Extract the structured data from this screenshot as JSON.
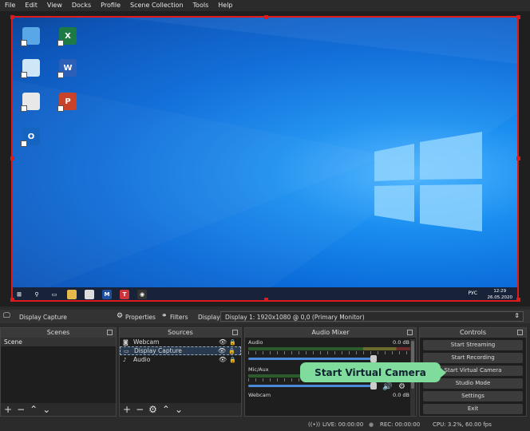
{
  "menu": [
    "File",
    "Edit",
    "View",
    "Docks",
    "Profile",
    "Scene Collection",
    "Tools",
    "Help"
  ],
  "desktop_icons": [
    {
      "name": "computer-icon",
      "glyph": "",
      "color": "#5aa7e8"
    },
    {
      "name": "excel-icon",
      "glyph": "X",
      "color": "#1d7a45"
    },
    {
      "name": "recycle-bin-icon",
      "glyph": "",
      "color": "#cfe6f7"
    },
    {
      "name": "word-icon",
      "glyph": "W",
      "color": "#2b5fb8"
    },
    {
      "name": "chrome-icon",
      "glyph": "",
      "color": "#e8e8e8"
    },
    {
      "name": "powerpoint-icon",
      "glyph": "P",
      "color": "#c9432a"
    },
    {
      "name": "outlook-icon",
      "glyph": "O",
      "color": "#1565c0"
    }
  ],
  "taskbar": {
    "lang": "РУС",
    "time": "12:29",
    "date": "26.05.2020",
    "apps": [
      {
        "name": "start-icon",
        "glyph": "⊞",
        "color": "transparent"
      },
      {
        "name": "search-icon",
        "glyph": "⚲",
        "color": "transparent"
      },
      {
        "name": "task-view-icon",
        "glyph": "▭",
        "color": "transparent"
      },
      {
        "name": "explorer-icon",
        "glyph": "",
        "color": "#e5b94a"
      },
      {
        "name": "chrome-task-icon",
        "glyph": "",
        "color": "#dcdcdc"
      },
      {
        "name": "malwarebytes-icon",
        "glyph": "M",
        "color": "#1f4fa0"
      },
      {
        "name": "t-app-icon",
        "glyph": "T",
        "color": "#d0343a"
      },
      {
        "name": "obs-icon",
        "glyph": "◉",
        "color": "#333"
      }
    ]
  },
  "source_bar": {
    "source_name": "Display Capture",
    "properties": "Properties",
    "filters": "Filters",
    "display_label": "Display",
    "display_value": "Display 1: 1920x1080 @ 0,0 (Primary Monitor)"
  },
  "scenes": {
    "title": "Scenes",
    "items": [
      "Scene"
    ]
  },
  "sources": {
    "title": "Sources",
    "items": [
      {
        "label": "Webcam",
        "icon": "camera-icon",
        "glyph": "◙"
      },
      {
        "label": "Display Capture",
        "icon": "monitor-icon",
        "glyph": "▭"
      },
      {
        "label": "Audio",
        "icon": "mic-icon",
        "glyph": "♪"
      }
    ]
  },
  "mixer": {
    "title": "Audio Mixer",
    "channels": [
      {
        "name": "Audio",
        "db": "0.0 dB"
      },
      {
        "name": "Mic/Aux",
        "db": ""
      },
      {
        "name": "Webcam",
        "db": "0.0 dB"
      }
    ]
  },
  "controls": {
    "title": "Controls",
    "buttons": [
      "Start Streaming",
      "Start Recording",
      "Start Virtual Camera",
      "Studio Mode",
      "Settings",
      "Exit"
    ]
  },
  "tooltip": "Start Virtual Camera",
  "status": {
    "live": "LIVE: 00:00:00",
    "rec": "REC: 00:00:00",
    "cpu": "CPU: 3.2%, 60.00 fps"
  }
}
